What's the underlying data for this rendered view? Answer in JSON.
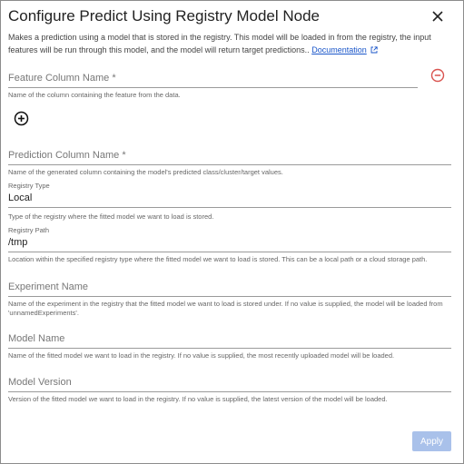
{
  "dialog": {
    "title": "Configure Predict Using Registry Model Node",
    "description": "Makes a prediction using a model that is stored in the registry. This model will be loaded in from the registry, the input features will be run through this model, and the model will return target predictions..",
    "doc_link": "Documentation",
    "close_icon": "close-icon"
  },
  "fields": {
    "feature_column": {
      "label": "Feature Column Name *",
      "value": "",
      "helper": "Name of the column containing the feature from the data."
    },
    "prediction_column": {
      "label": "Prediction Column Name *",
      "value": "",
      "helper": "Name of the generated column containing the model's predicted class/cluster/target values."
    },
    "registry_type": {
      "label": "Registry Type",
      "value": "Local",
      "helper": "Type of the registry where the fitted model we want to load is stored."
    },
    "registry_path": {
      "label": "Registry Path",
      "value": "/tmp",
      "helper": "Location within the specified registry type where the fitted model we want to load is stored. This can be a local path or a cloud storage path."
    },
    "experiment_name": {
      "label": "Experiment Name",
      "value": "",
      "helper": "Name of the experiment in the registry that the fitted model we want to load is stored under. If no value is supplied, the model will be loaded from 'unnamedExperiments'."
    },
    "model_name": {
      "label": "Model Name",
      "value": "",
      "helper": "Name of the fitted model we want to load in the registry. If no value is supplied, the most recently uploaded model will be loaded."
    },
    "model_version": {
      "label": "Model Version",
      "value": "",
      "helper": "Version of the fitted model we want to load in the registry. If no value is supplied, the latest version of the model will be loaded."
    }
  },
  "actions": {
    "apply_label": "Apply"
  },
  "colors": {
    "remove_icon": "#d9534f",
    "apply_button": "#a9c1ea",
    "link": "#1a56c9"
  }
}
